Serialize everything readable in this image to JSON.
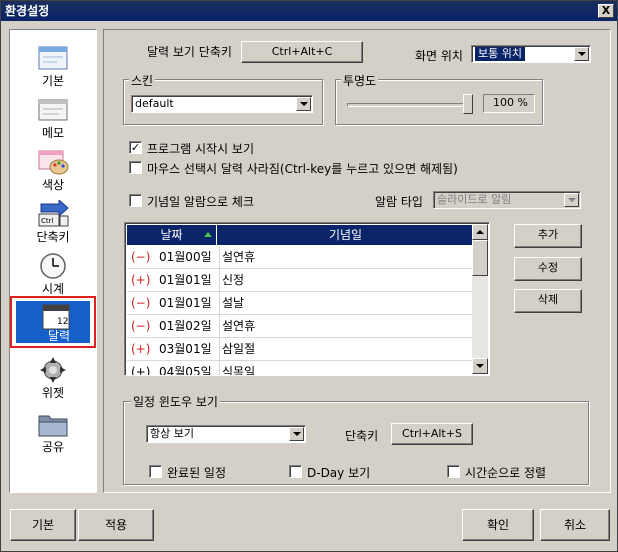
{
  "window": {
    "title": "환경설정",
    "close_label": "X"
  },
  "sidebar": {
    "items": [
      {
        "label": "기본",
        "icon": "window-icon"
      },
      {
        "label": "메모",
        "icon": "memo-window-icon"
      },
      {
        "label": "색상",
        "icon": "palette-icon"
      },
      {
        "label": "단축키",
        "icon": "ctrl-key-icon",
        "key_text": "Ctrl"
      },
      {
        "label": "시계",
        "icon": "clock-icon"
      },
      {
        "label": "달력",
        "icon": "calendar-icon",
        "selected": true,
        "day_text": "12"
      },
      {
        "label": "위젯",
        "icon": "widget-icon"
      },
      {
        "label": "공유",
        "icon": "folder-icon"
      }
    ]
  },
  "calendar_hotkey": {
    "label": "달력 보기 단축키",
    "value": "Ctrl+Alt+C"
  },
  "screen_position": {
    "label": "화면 위치",
    "value": "보통 위치"
  },
  "skin": {
    "label": "스킨",
    "value": "default"
  },
  "opacity": {
    "label": "투명도",
    "value": "100 %",
    "percent": 100
  },
  "options": {
    "show_on_start": {
      "label": "프로그램 시작시 보기",
      "checked": true
    },
    "hide_on_mouse": {
      "label": "마우스 선택시 달력 사라짐(Ctrl-key를 누르고 있으면 해제됨)",
      "checked": false
    },
    "anniversary_alarm": {
      "label": "기념일 알람으로 체크",
      "checked": false
    }
  },
  "alarm_type": {
    "label": "알람 타입",
    "value": "슬라이드로 알림"
  },
  "table": {
    "headers": {
      "date": "날짜",
      "name": "기념일"
    },
    "rows": [
      {
        "sign": "(−)",
        "date": "01월00일",
        "name": "설연휴"
      },
      {
        "sign": "(+)",
        "date": "01월01일",
        "name": "신정"
      },
      {
        "sign": "(−)",
        "date": "01월01일",
        "name": "설날"
      },
      {
        "sign": "(−)",
        "date": "01월02일",
        "name": "설연휴"
      },
      {
        "sign": "(+)",
        "date": "03월01일",
        "name": "삼일절"
      },
      {
        "sign": "(+)",
        "date": "04월05일",
        "name": "식목일"
      }
    ]
  },
  "table_buttons": {
    "add": "추가",
    "edit": "수정",
    "delete": "삭제"
  },
  "schedule": {
    "group_label": "일정 윈도우 보기",
    "mode_value": "항상 보기",
    "hotkey_label": "단축키",
    "hotkey_value": "Ctrl+Alt+S",
    "completed": {
      "label": "완료된 일정",
      "checked": false
    },
    "dday": {
      "label": "D-Day 보기",
      "checked": false
    },
    "sort_time": {
      "label": "시간순으로 정렬",
      "checked": false
    }
  },
  "footer": {
    "default": "기본",
    "apply": "적용",
    "ok": "확인",
    "cancel": "취소"
  },
  "colors": {
    "title_bar": "#0a246a",
    "selection": "#1560c8",
    "highlight_box": "#e02020",
    "sign_red": "#d02020"
  }
}
